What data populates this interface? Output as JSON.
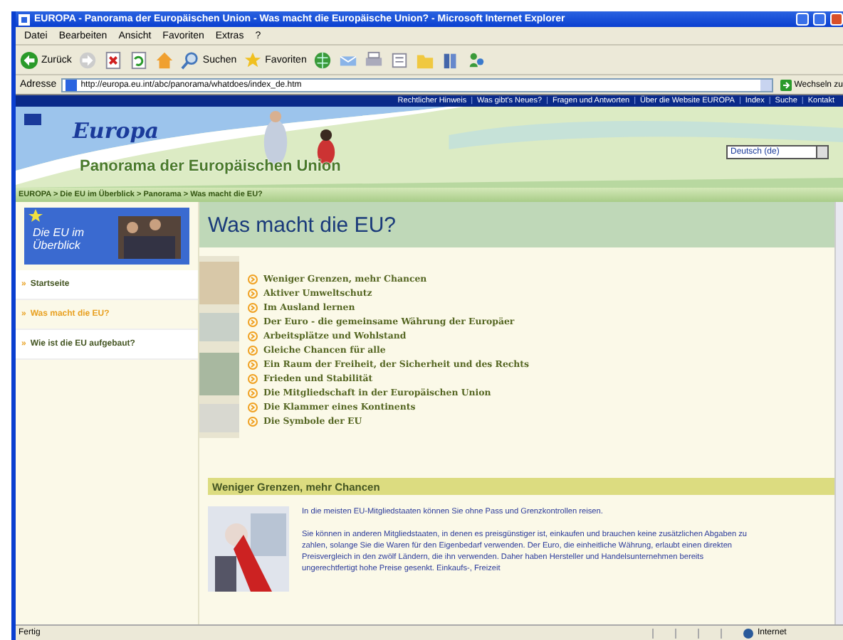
{
  "window": {
    "title": "EUROPA - Panorama der Europäischen Union - Was macht die Europäische Union? - Microsoft Internet Explorer"
  },
  "menu": [
    "Datei",
    "Bearbeiten",
    "Ansicht",
    "Favoriten",
    "Extras",
    "?"
  ],
  "toolbar": [
    {
      "kind": "back",
      "label": "Zurück"
    },
    {
      "kind": "forward"
    },
    {
      "kind": "stop"
    },
    {
      "kind": "refresh"
    },
    {
      "kind": "home"
    },
    {
      "kind": "search",
      "label": "Suchen"
    },
    {
      "kind": "favorites",
      "label": "Favoriten"
    },
    {
      "kind": "media"
    },
    {
      "kind": "mail"
    },
    {
      "kind": "print"
    },
    {
      "kind": "edit"
    },
    {
      "kind": "folder"
    },
    {
      "kind": "research"
    },
    {
      "kind": "messenger"
    }
  ],
  "address": {
    "label": "Adresse",
    "url": "http://europa.eu.int/abc/panorama/whatdoes/index_de.htm",
    "go": "Wechseln zu"
  },
  "top_links": [
    {
      "kind": "link",
      "text": "Rechtlicher Hinweis"
    },
    {
      "kind": "separator",
      "text": "|"
    },
    {
      "kind": "link",
      "text": "Was gibt's Neues?"
    },
    {
      "kind": "separator",
      "text": "|"
    },
    {
      "kind": "link",
      "text": "Fragen und Antworten"
    },
    {
      "kind": "separator",
      "text": "|"
    },
    {
      "kind": "link",
      "text": "Über die Website EUROPA"
    },
    {
      "kind": "separator",
      "text": "|"
    },
    {
      "kind": "link",
      "text": "Index"
    },
    {
      "kind": "separator",
      "text": "|"
    },
    {
      "kind": "link",
      "text": "Suche"
    },
    {
      "kind": "separator",
      "text": "|"
    },
    {
      "kind": "link",
      "text": "Kontakt"
    }
  ],
  "banner": {
    "logo": "Europa",
    "subtitle": "Panorama der Europäischen Union",
    "language": "Deutsch (de)"
  },
  "breadcrumb": "EUROPA > Die EU im Überblick > Panorama > Was macht die EU?",
  "sidebar": {
    "badge": "Die EU im Überblick",
    "items": [
      {
        "bullet": "»",
        "label": "Startseite",
        "selected": false
      },
      {
        "bullet": "»",
        "label": "Was macht die EU?",
        "selected": true
      },
      {
        "bullet": "»",
        "label": "Wie ist die EU aufgebaut?",
        "selected": false
      }
    ]
  },
  "heading": "Was macht die EU?",
  "topics": [
    "Weniger Grenzen, mehr Chancen",
    "Aktiver Umweltschutz",
    "Im Ausland lernen",
    "Der Euro - die gemeinsame Währung der Europäer",
    "Arbeitsplätze und Wohlstand",
    "Gleiche Chancen für alle",
    "Ein Raum der Freiheit, der Sicherheit und des Rechts",
    "Frieden und Stabilität",
    "Die Mitgliedschaft in der Europäischen Union",
    "Die Klammer eines Kontinents",
    "Die Symbole der EU"
  ],
  "section": {
    "title": "Weniger Grenzen, mehr Chancen",
    "paragraphs": [
      "In die meisten EU-Mitgliedstaaten können Sie ohne Pass und Grenzkontrollen reisen.",
      "Sie können in anderen Mitgliedstaaten, in denen es preisgünstiger ist, einkaufen und brauchen keine zusätzlichen Abgaben zu zahlen, solange Sie die Waren für den Eigenbedarf verwenden. Der Euro, die einheitliche Währung, erlaubt einen direkten Preisvergleich in den zwölf Ländern, die ihn verwenden. Daher haben Hersteller und Handelsunternehmen bereits ungerechtfertigt hohe Preise gesenkt. Einkaufs-, Freizeit"
    ]
  },
  "status": {
    "text": "Fertig",
    "zone": "Internet"
  }
}
